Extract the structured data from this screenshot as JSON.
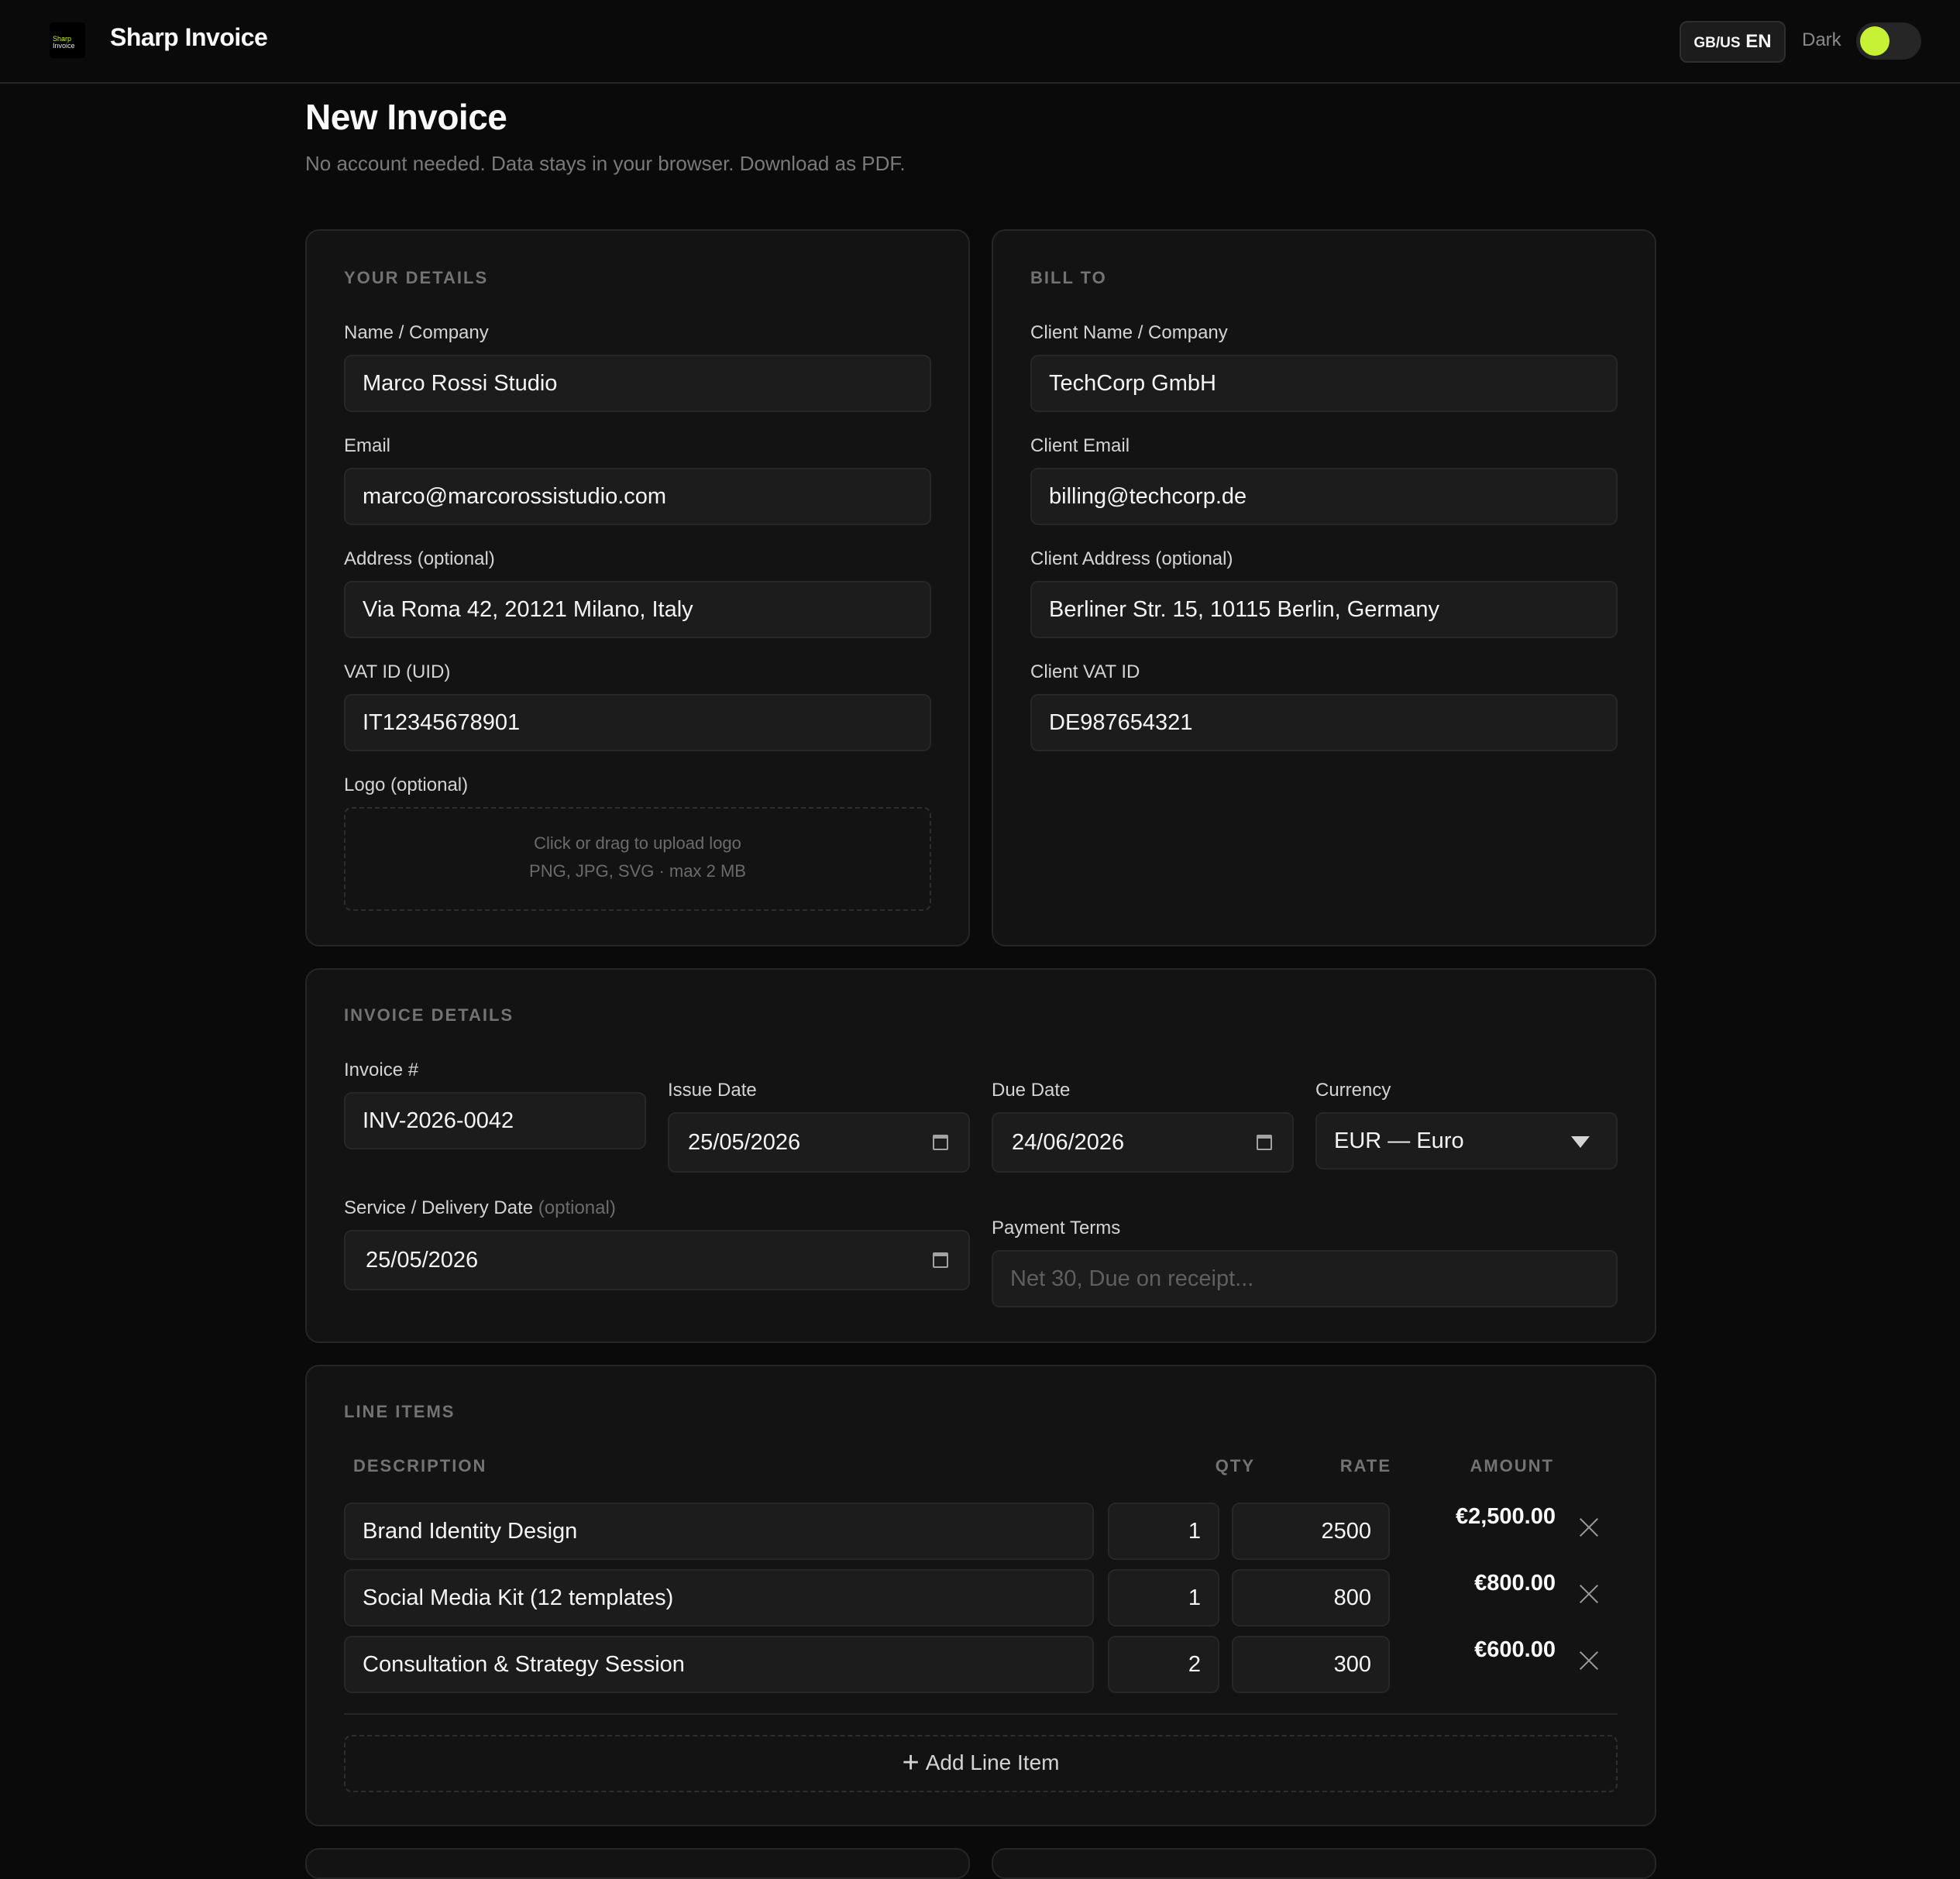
{
  "header": {
    "logo_line1": "Sharp",
    "logo_line2": "Invoice",
    "app_name": "Sharp Invoice",
    "lang_flag": "GB/US",
    "lang_code": "EN",
    "theme_label": "Dark",
    "accent_color": "#c6f135"
  },
  "page": {
    "title": "New Invoice",
    "subtitle": "No account needed. Data stays in your browser. Download as PDF."
  },
  "your_details": {
    "section_title": "YOUR DETAILS",
    "name_label": "Name / Company",
    "name_value": "Marco Rossi Studio",
    "email_label": "Email",
    "email_value": "marco@marcorossistudio.com",
    "address_label": "Address (optional)",
    "address_value": "Via Roma 42, 20121 Milano, Italy",
    "vat_label": "VAT ID (UID)",
    "vat_value": "IT12345678901",
    "logo_label": "Logo (optional)",
    "logo_hint_1": "Click or drag to upload logo",
    "logo_hint_2": "PNG, JPG, SVG · max 2 MB"
  },
  "bill_to": {
    "section_title": "BILL TO",
    "name_label": "Client Name / Company",
    "name_value": "TechCorp GmbH",
    "email_label": "Client Email",
    "email_value": "billing@techcorp.de",
    "address_label": "Client Address (optional)",
    "address_value": "Berliner Str. 15, 10115 Berlin, Germany",
    "vat_label": "Client VAT ID",
    "vat_value": "DE987654321"
  },
  "invoice_details": {
    "section_title": "INVOICE DETAILS",
    "number_label": "Invoice #",
    "number_value": "INV-2026-0042",
    "issue_label": "Issue Date",
    "issue_value": "25/05/2026",
    "due_label": "Due Date",
    "due_value": "24/06/2026",
    "currency_label": "Currency",
    "currency_value": "EUR — Euro",
    "service_label": "Service / Delivery Date",
    "service_label_opt": "(optional)",
    "service_value": "25/05/2026",
    "terms_label": "Payment Terms",
    "terms_placeholder": "Net 30, Due on receipt..."
  },
  "line_items": {
    "section_title": "LINE ITEMS",
    "col_description": "DESCRIPTION",
    "col_qty": "QTY",
    "col_rate": "RATE",
    "col_amount": "AMOUNT",
    "items": [
      {
        "description": "Brand Identity Design",
        "qty": "1",
        "rate": "2500",
        "amount": "€2,500.00"
      },
      {
        "description": "Social Media Kit (12 templates)",
        "qty": "1",
        "rate": "800",
        "amount": "€800.00"
      },
      {
        "description": "Consultation & Strategy Session",
        "qty": "2",
        "rate": "300",
        "amount": "€600.00"
      }
    ],
    "add_label": "Add Line Item"
  }
}
